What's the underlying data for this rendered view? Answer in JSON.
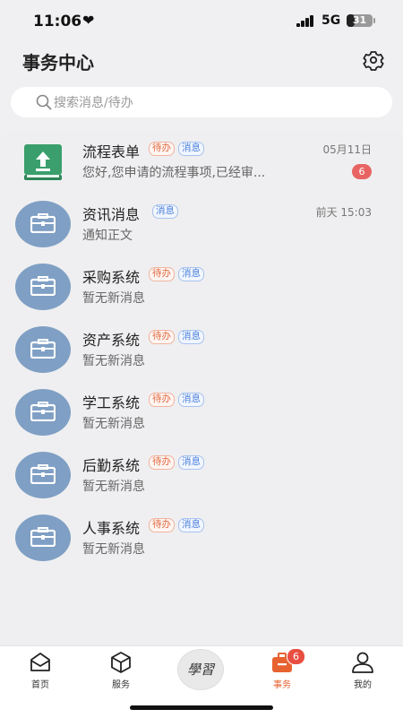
{
  "status_bar": {
    "time": "11:06",
    "network": "5G",
    "battery": "31"
  },
  "header": {
    "title": "事务中心"
  },
  "search": {
    "placeholder": "搜索消息/待办"
  },
  "tags": {
    "todo": "待办",
    "message": "消息"
  },
  "items": [
    {
      "title": "流程表单",
      "subtitle": "您好,您申请的流程事项,已经审...",
      "time": "05月11日",
      "badge": "6",
      "tags": [
        "待办",
        "消息"
      ]
    },
    {
      "title": "资讯消息",
      "subtitle": "通知正文",
      "time": "前天 15:03",
      "tags": [
        "消息"
      ]
    },
    {
      "title": "采购系统",
      "subtitle": "暂无新消息",
      "tags": [
        "待办",
        "消息"
      ]
    },
    {
      "title": "资产系统",
      "subtitle": "暂无新消息",
      "tags": [
        "待办",
        "消息"
      ]
    },
    {
      "title": "学工系统",
      "subtitle": "暂无新消息",
      "tags": [
        "待办",
        "消息"
      ]
    },
    {
      "title": "后勤系统",
      "subtitle": "暂无新消息",
      "tags": [
        "待办",
        "消息"
      ]
    },
    {
      "title": "人事系统",
      "subtitle": "暂无新消息",
      "tags": [
        "待办",
        "消息"
      ]
    }
  ],
  "tabbar": {
    "home": "首页",
    "service": "服务",
    "center_glyph": "學習",
    "affairs": "事务",
    "affairs_badge": "6",
    "mine": "我的"
  },
  "colors": {
    "accent": "#e8622f",
    "avatar": "#7f9fc4",
    "form_icon": "#3a9f6c",
    "badge": "#e86463"
  }
}
